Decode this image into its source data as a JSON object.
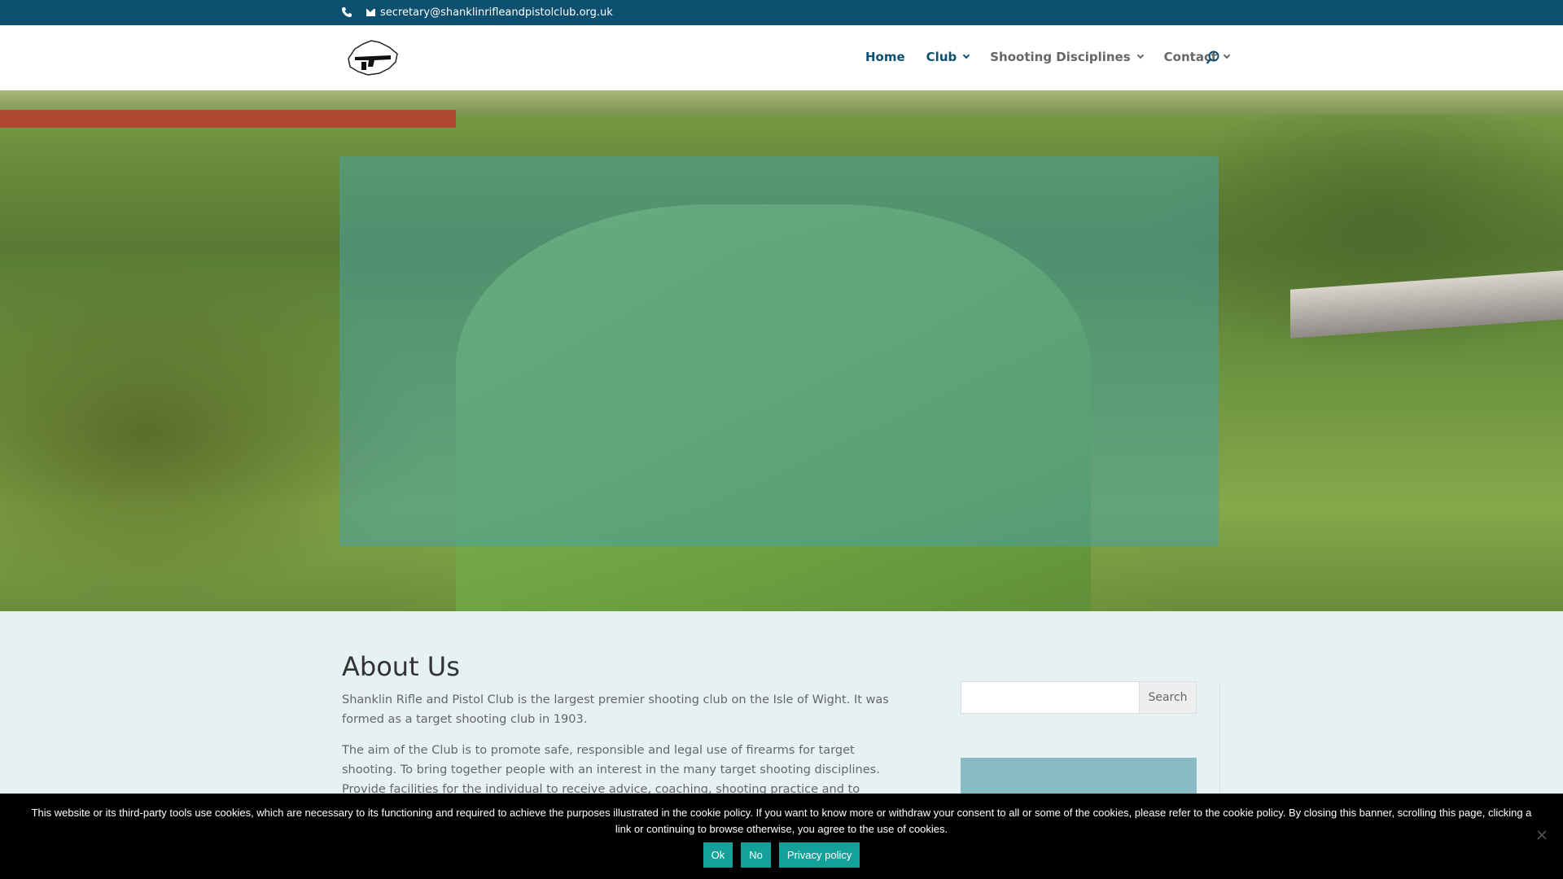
{
  "topbar": {
    "phone_icon": "phone-icon",
    "mail_icon": "envelope-icon",
    "email": "secretary@shanklinrifleandpistolclub.org.uk"
  },
  "header": {
    "logo_icon": "club-logo",
    "nav": [
      {
        "label": "Home",
        "active": true,
        "dropdown": false
      },
      {
        "label": "Club",
        "active": true,
        "dropdown": true
      },
      {
        "label": "Shooting Disciplines",
        "active": false,
        "dropdown": true
      },
      {
        "label": "Contact",
        "active": false,
        "dropdown": true
      }
    ],
    "search_icon": "search-icon"
  },
  "colors": {
    "accent": "#0d4f6e",
    "overlay": "#4ba0a0",
    "background": "#e6f1f4",
    "cookie_button": "#14a19a"
  },
  "main": {
    "title": "About Us",
    "paragraphs": [
      "Shanklin Rifle and Pistol Club is the largest premier shooting club on the Isle of Wight. It was formed as a target shooting club in 1903.",
      "The aim of the Club is to promote safe, responsible and legal use of firearms for target shooting. To bring together people with an interest in the many target shooting disciplines. Provide facilities for the individual to receive advice, coaching, shooting practice and to compete against others at all levels (Novice to"
    ]
  },
  "sidebar": {
    "search_placeholder": "",
    "search_button": "Search"
  },
  "cookie": {
    "text": "This website or its third-party tools use cookies, which are necessary to its functioning and required to achieve the purposes illustrated in the cookie policy. If you want to know more or withdraw your consent to all or some of the cookies, please refer to the cookie policy. By closing this banner, scrolling this page, clicking a link or continuing to browse otherwise, you agree to the use of cookies.",
    "ok": "Ok",
    "no": "No",
    "privacy": "Privacy policy",
    "close_icon": "close-icon"
  }
}
